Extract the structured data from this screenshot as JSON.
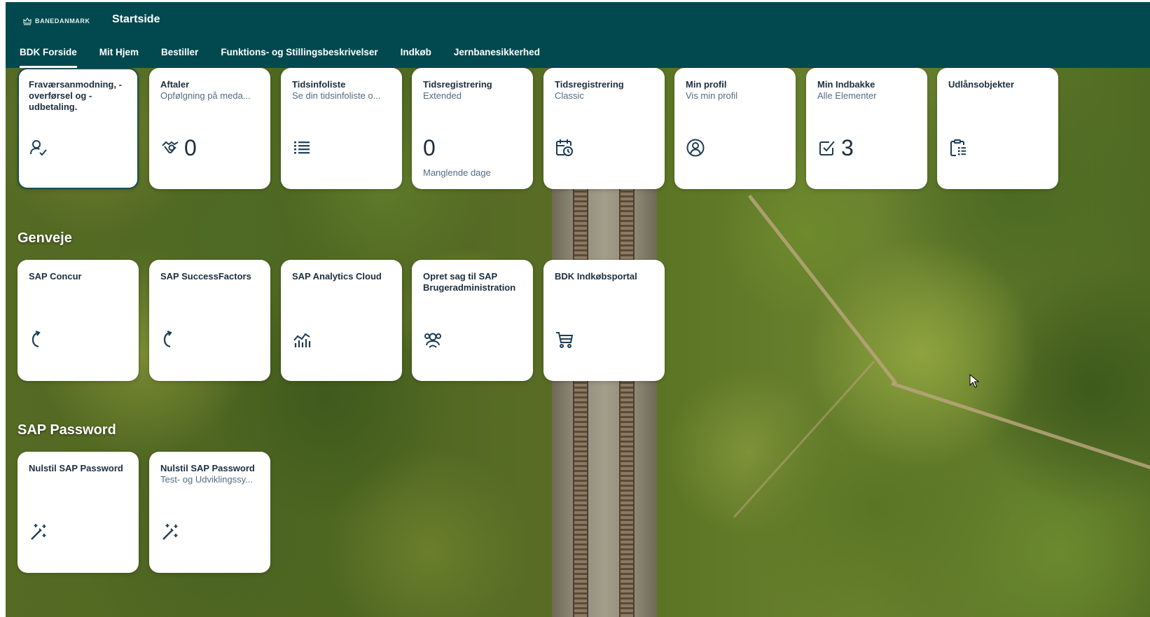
{
  "shell": {
    "logo_text": "BANEDANMARK",
    "title": "Startside",
    "tabs": [
      {
        "label": "BDK Forside",
        "active": true
      },
      {
        "label": "Mit Hjem"
      },
      {
        "label": "Bestiller"
      },
      {
        "label": "Funktions- og Stillingsbeskrivelser"
      },
      {
        "label": "Indkøb"
      },
      {
        "label": "Jernbanesikkerhed"
      }
    ]
  },
  "top_tiles": [
    {
      "title": "Fraværsanmodning, -overførsel og -udbetaling.",
      "subtitle": "",
      "icon": "person-check-icon",
      "number": "",
      "footer": ""
    },
    {
      "title": "Aftaler",
      "subtitle": "Opfølgning på meda...",
      "icon": "handshake-icon",
      "number": "0",
      "footer": ""
    },
    {
      "title": "Tidsinfoliste",
      "subtitle": "Se din tidsinfoliste o...",
      "icon": "list-icon",
      "number": "",
      "footer": ""
    },
    {
      "title": "Tidsregistrering",
      "subtitle": "Extended",
      "icon": "",
      "number": "0",
      "footer": "Manglende dage"
    },
    {
      "title": "Tidsregistrering",
      "subtitle": "Classic",
      "icon": "calendar-clock-icon",
      "number": "",
      "footer": ""
    },
    {
      "title": "Min profil",
      "subtitle": "Vis min profil",
      "icon": "user-circle-icon",
      "number": "",
      "footer": ""
    },
    {
      "title": "Min Indbakke",
      "subtitle": "Alle Elementer",
      "icon": "checkbox-icon",
      "number": "3",
      "footer": ""
    },
    {
      "title": "Udlånsobjekter",
      "subtitle": "",
      "icon": "clipboard-list-icon",
      "number": "",
      "footer": ""
    }
  ],
  "sections": [
    {
      "title": "Genveje",
      "tiles": [
        {
          "title": "SAP Concur",
          "subtitle": "",
          "icon": "redo-icon"
        },
        {
          "title": "SAP SuccessFactors",
          "subtitle": "",
          "icon": "redo-icon"
        },
        {
          "title": "SAP Analytics Cloud",
          "subtitle": "",
          "icon": "analytics-icon"
        },
        {
          "title": "Opret sag til SAP Brugeradministration",
          "subtitle": "",
          "icon": "user-group-icon"
        },
        {
          "title": "BDK Indkøbsportal",
          "subtitle": "",
          "icon": "cart-icon"
        }
      ]
    },
    {
      "title": "SAP Password",
      "tiles": [
        {
          "title": "Nulstil SAP Password",
          "subtitle": "",
          "icon": "magic-wand-icon"
        },
        {
          "title": "Nulstil SAP Password",
          "subtitle": "Test- og Udviklingssy...",
          "icon": "magic-wand-icon"
        }
      ]
    }
  ],
  "colors": {
    "shell_bg": "#02494f",
    "tile_text": "#1d2d3e",
    "tile_sub": "#556b82",
    "icon": "#1d3d55"
  }
}
